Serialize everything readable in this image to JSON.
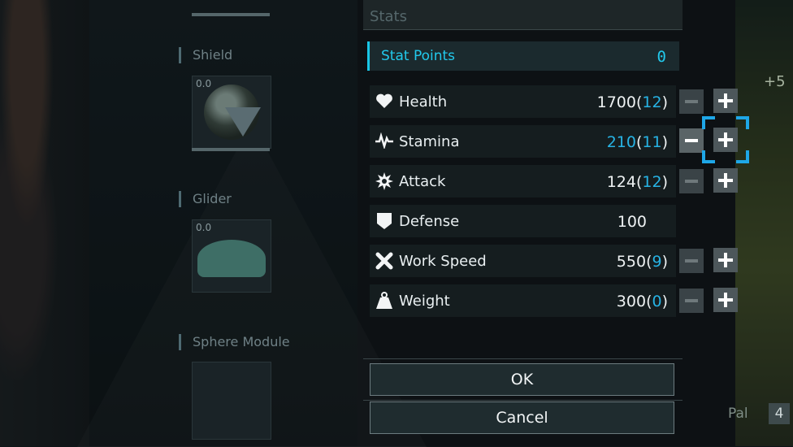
{
  "equipment": {
    "shield": {
      "label": "Shield",
      "value": "0.0"
    },
    "glider": {
      "label": "Glider",
      "value": "0.0"
    },
    "sphere_module": {
      "label": "Sphere Module"
    }
  },
  "stats_panel": {
    "title": "Stats",
    "stat_points": {
      "label": "Stat Points",
      "value": "0"
    },
    "rows": [
      {
        "icon": "heart-icon",
        "label": "Health",
        "value": "1700",
        "points": "12",
        "boosted": false,
        "adjustable": true
      },
      {
        "icon": "pulse-icon",
        "label": "Stamina",
        "value": "210",
        "points": "11",
        "boosted": true,
        "adjustable": true
      },
      {
        "icon": "spiked-gear-icon",
        "label": "Attack",
        "value": "124",
        "points": "12",
        "boosted": false,
        "adjustable": true
      },
      {
        "icon": "shield-icon",
        "label": "Defense",
        "value": "100",
        "points": null,
        "boosted": false,
        "adjustable": false
      },
      {
        "icon": "work-tools-icon",
        "label": "Work Speed",
        "value": "550",
        "points": "9",
        "boosted": false,
        "adjustable": true
      },
      {
        "icon": "weight-icon",
        "label": "Weight",
        "value": "300",
        "points": "0",
        "boosted": false,
        "adjustable": true
      }
    ],
    "ok_label": "OK",
    "cancel_label": "Cancel"
  },
  "side_info": {
    "boost_text": "+5",
    "pal_label": "Pal",
    "pal_count": "4"
  },
  "colors": {
    "accent": "#22c9ec",
    "boost": "#27b3e4",
    "selector": "#1ea7e8"
  }
}
